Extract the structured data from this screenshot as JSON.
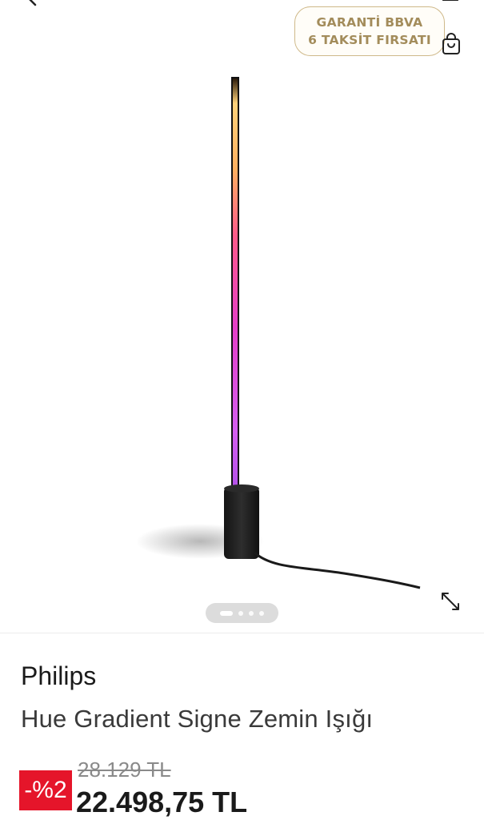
{
  "header": {
    "back_icon": "chevron-left-icon",
    "cart_icon": "cart-icon",
    "bag_icon": "shopping-bag-icon"
  },
  "promo": {
    "line1": "GARANTİ BBVA",
    "line2": "6 TAKSİT FIRSATI",
    "text_color": "#a38c5b",
    "border_color": "#cfb98a"
  },
  "gallery": {
    "image_alt": "Philips Hue Gradient Signe floor lamp",
    "page_count": 4,
    "active_page": 1,
    "expand_icon": "expand-icon"
  },
  "product": {
    "brand": "Philips",
    "title": "Hue Gradient Signe Zemin Işığı",
    "discount": "-%2",
    "old_price": "28.129 TL",
    "price": "22.498,75 TL",
    "discount_color": "#e5152a"
  }
}
